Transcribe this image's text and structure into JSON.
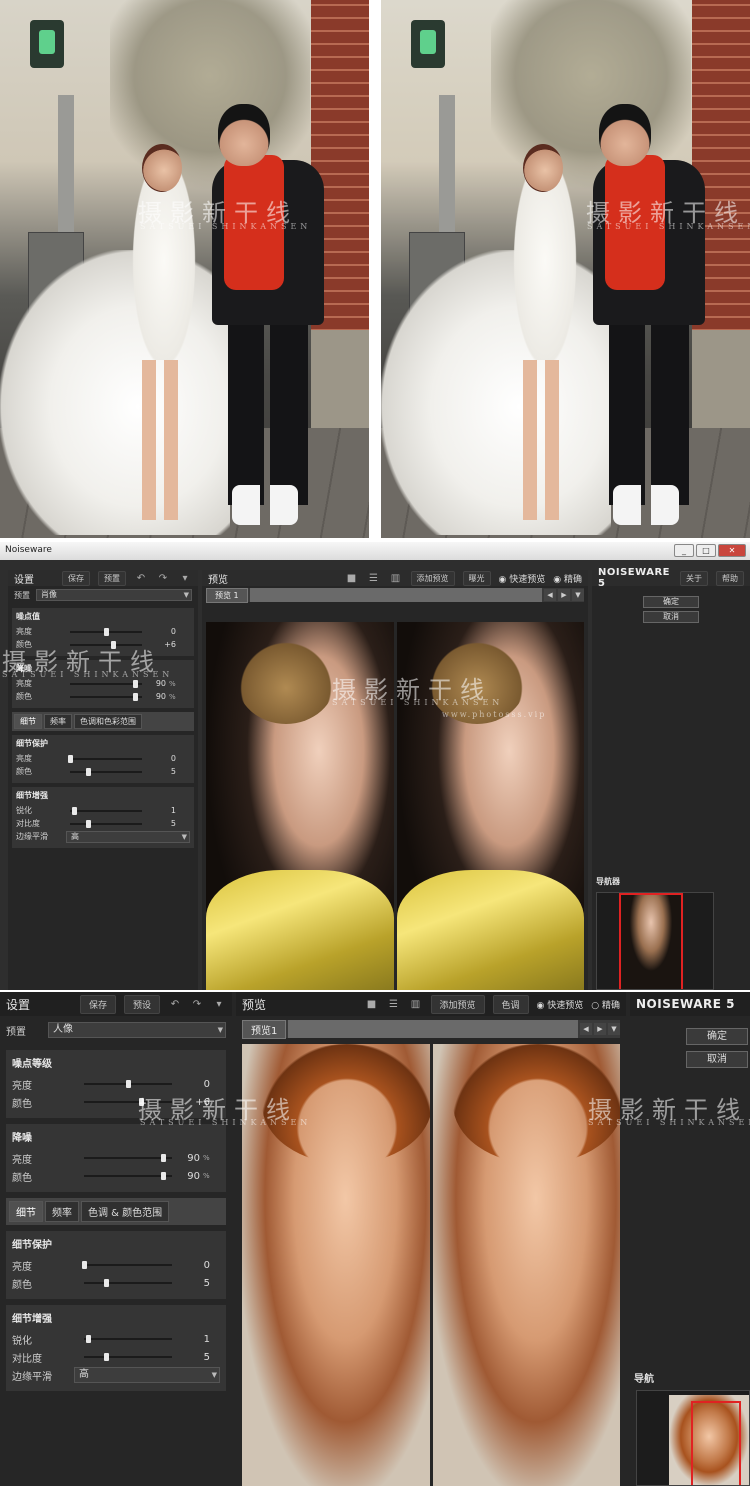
{
  "watermark": {
    "cn": "摄影新干线",
    "en": "SATSUEI SHINKANSEN",
    "url": "www.photosss.vip"
  },
  "window": {
    "title": "Noiseware",
    "controls": [
      "_",
      "□",
      "✕"
    ]
  },
  "app1": {
    "left_panel": {
      "title": "设置",
      "save_label": "保存",
      "preset_button": "预置",
      "preset_label": "预置",
      "preset_value": "肖像",
      "noise_level": {
        "title": "噪点值",
        "rows": [
          {
            "label": "亮度",
            "value": "0",
            "pos": 0.5
          },
          {
            "label": "颜色",
            "value": "+6",
            "pos": 0.6
          }
        ]
      },
      "noise_reduction": {
        "title": "降噪",
        "rows": [
          {
            "label": "亮度",
            "value": "90",
            "unit": "%",
            "pos": 0.9
          },
          {
            "label": "颜色",
            "value": "90",
            "unit": "%",
            "pos": 0.9
          }
        ]
      },
      "tabs": [
        "细节",
        "频率",
        "色调和色彩范围"
      ],
      "detail_protect": {
        "title": "细节保护",
        "rows": [
          {
            "label": "亮度",
            "value": "0",
            "pos": 0.0
          },
          {
            "label": "颜色",
            "value": "5",
            "pos": 0.25
          }
        ]
      },
      "detail_enhance": {
        "title": "细节增强",
        "rows": [
          {
            "label": "锐化",
            "value": "1",
            "pos": 0.05
          },
          {
            "label": "对比度",
            "value": "5",
            "pos": 0.25
          }
        ],
        "edge_label": "边缘平滑",
        "edge_value": "高"
      }
    },
    "center": {
      "title": "预览",
      "add_preview": "添加预览",
      "exposure": "曝光",
      "fast_preview": "快速预览",
      "accurate": "精确",
      "tab": "预览 1"
    },
    "right": {
      "brand": "NOISEWARE 5",
      "about": "关于",
      "help": "帮助",
      "ok": "确定",
      "cancel": "取消",
      "navigator": "导航器"
    }
  },
  "app2": {
    "left_panel": {
      "title": "设置",
      "save_label": "保存",
      "preset_button": "预设",
      "preset_label": "预置",
      "preset_value": "人像",
      "noise_level": {
        "title": "噪点等级",
        "rows": [
          {
            "label": "亮度",
            "value": "0",
            "pos": 0.5
          },
          {
            "label": "颜色",
            "value": "+6",
            "pos": 0.65
          }
        ]
      },
      "noise_reduction": {
        "title": "降噪",
        "rows": [
          {
            "label": "亮度",
            "value": "90",
            "unit": "%",
            "pos": 0.9
          },
          {
            "label": "颜色",
            "value": "90",
            "unit": "%",
            "pos": 0.9
          }
        ]
      },
      "tabs": [
        "细节",
        "频率",
        "色调 & 颜色范围"
      ],
      "detail_protect": {
        "title": "细节保护",
        "rows": [
          {
            "label": "亮度",
            "value": "0",
            "pos": 0.0
          },
          {
            "label": "颜色",
            "value": "5",
            "pos": 0.25
          }
        ]
      },
      "detail_enhance": {
        "title": "细节增强",
        "rows": [
          {
            "label": "锐化",
            "value": "1",
            "pos": 0.05
          },
          {
            "label": "对比度",
            "value": "5",
            "pos": 0.25
          }
        ],
        "edge_label": "边缘平滑",
        "edge_value": "高"
      }
    },
    "center": {
      "title": "预览",
      "add_preview": "添加预览",
      "exposure": "色调",
      "fast_preview": "快速预览",
      "accurate": "精确",
      "tab": "预览1"
    },
    "right": {
      "brand": "NOISEWARE 5",
      "ok": "确定",
      "cancel": "取消",
      "navigator": "导航"
    }
  }
}
